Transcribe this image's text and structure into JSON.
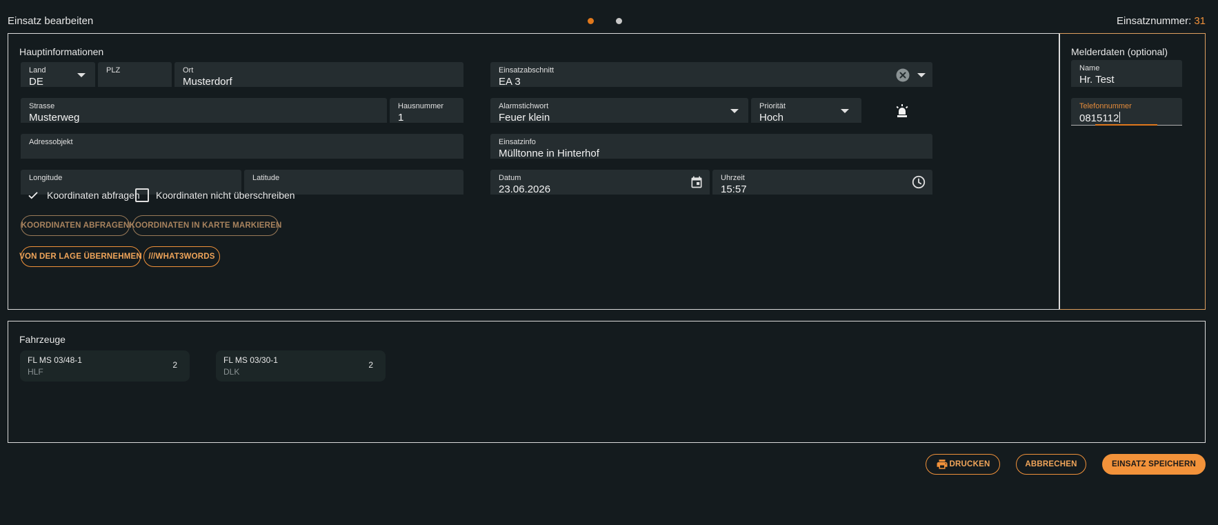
{
  "header": {
    "title": "Einsatz bearbeiten",
    "einsatznummer_label": "Einsatznummer:",
    "einsatznummer_value": "31"
  },
  "main": {
    "title": "Hauptinformationen",
    "land": {
      "label": "Land",
      "value": "DE"
    },
    "plz": {
      "label": "PLZ",
      "value": ""
    },
    "ort": {
      "label": "Ort",
      "value": "Musterdorf"
    },
    "strasse": {
      "label": "Strasse",
      "value": "Musterweg"
    },
    "hausnummer": {
      "label": "Hausnummer",
      "value": "1"
    },
    "adressobjekt": {
      "label": "Adressobjekt",
      "value": ""
    },
    "longitude": {
      "label": "Longitude",
      "value": ""
    },
    "latitude": {
      "label": "Latitude",
      "value": ""
    },
    "einsatzabschnitt": {
      "label": "Einsatzabschnitt",
      "value": "EA 3"
    },
    "alarmstichwort": {
      "label": "Alarmstichwort",
      "value": "Feuer klein"
    },
    "prioritaet": {
      "label": "Priorität",
      "value": "Hoch"
    },
    "einsatzinfo": {
      "label": "Einsatzinfo",
      "value": "Mülltonne in Hinterhof"
    },
    "datum": {
      "label": "Datum",
      "value": "23.06.2026"
    },
    "uhrzeit": {
      "label": "Uhrzeit",
      "value": "15:57"
    },
    "checks": {
      "koordinaten_abfragen": "Koordinaten abfragen",
      "koordinaten_nicht_ueberschreiben": "Koordinaten nicht überschreiben"
    },
    "buttons": {
      "koordinaten_abfragen": "KOORDINATEN ABFRAGEN",
      "koordinaten_markieren": "KOORDINATEN IN KARTE MARKIEREN",
      "von_lage": "VON DER LAGE ÜBERNEHMEN",
      "what3words": "///WHAT3WORDS"
    }
  },
  "melder": {
    "title": "Melderdaten (optional)",
    "name": {
      "label": "Name",
      "value": "Hr. Test"
    },
    "telefon": {
      "label": "Telefonnummer",
      "value": "0815112"
    }
  },
  "fahrzeuge": {
    "title": "Fahrzeuge",
    "items": [
      {
        "name": "FL MS 03/48-1",
        "type": "HLF",
        "count": "2"
      },
      {
        "name": "FL MS 03/30-1",
        "type": "DLK",
        "count": "2"
      }
    ]
  },
  "footer": {
    "drucken": "DRUCKEN",
    "abbrechen": "ABBRECHEN",
    "speichern": "EINSATZ SPEICHERN"
  },
  "colors": {
    "accent": "#f0913a",
    "background": "#141b1e",
    "field": "#252d30"
  }
}
